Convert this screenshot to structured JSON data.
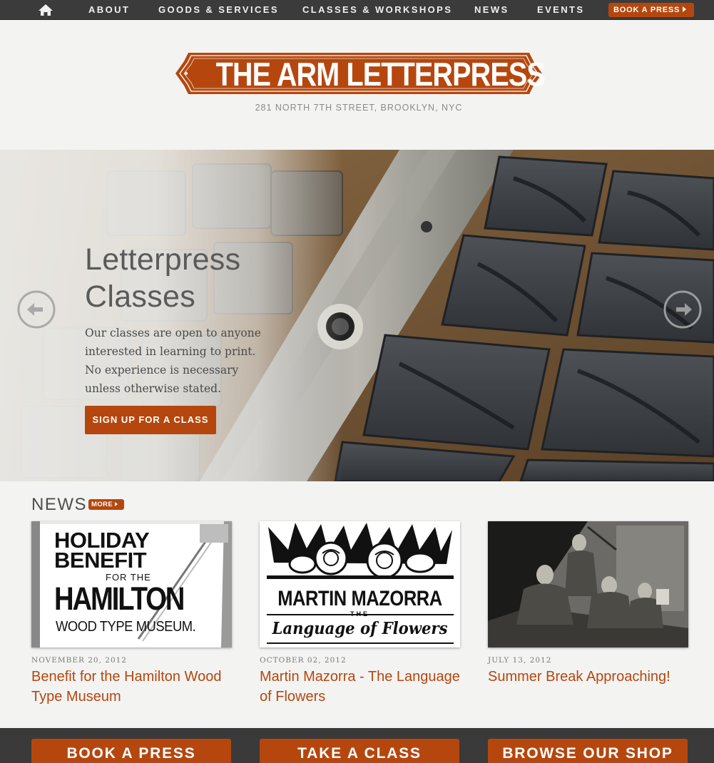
{
  "nav": {
    "items": [
      "ABOUT",
      "GOODS & SERVICES",
      "CLASSES & WORKSHOPS",
      "NEWS",
      "EVENTS"
    ],
    "book_label": "BOOK A PRESS"
  },
  "header": {
    "logo_text": "THE ARM LETTERPRESS",
    "address": "281 NORTH 7TH STREET, BROOKLYN, NYC"
  },
  "hero": {
    "title_line1": "Letterpress",
    "title_line2": "Classes",
    "description": "Our classes are open to anyone interested in learning to print. No experience is necessary unless otherwise stated.",
    "cta_label": "SIGN UP FOR A CLASS"
  },
  "news": {
    "heading": "NEWS",
    "more_label": "MORE",
    "items": [
      {
        "date": "NOVEMBER 20, 2012",
        "title": "Benefit for the Hamilton Wood Type Museum",
        "thumb": {
          "line1": "HOLIDAY",
          "line2": "BENEFIT",
          "line3": "FOR THE",
          "line4": "HAMILTON",
          "line5": "WOOD TYPE MUSEUM."
        }
      },
      {
        "date": "OCTOBER 02, 2012",
        "title": "Martin Mazorra - The Language of Flowers",
        "thumb": {
          "line1": "MARTIN MAZORRA",
          "line2": "THE",
          "line3": "Language of Flowers"
        }
      },
      {
        "date": "JULY 13, 2012",
        "title": "Summer Break Approaching!"
      }
    ]
  },
  "footer": {
    "buttons": [
      "BOOK A PRESS",
      "TAKE A CLASS",
      "BROWSE OUR SHOP"
    ]
  },
  "colors": {
    "accent": "#b5470e",
    "nav_bg": "#3b3b3b",
    "page_bg": "#f3f3f2"
  }
}
